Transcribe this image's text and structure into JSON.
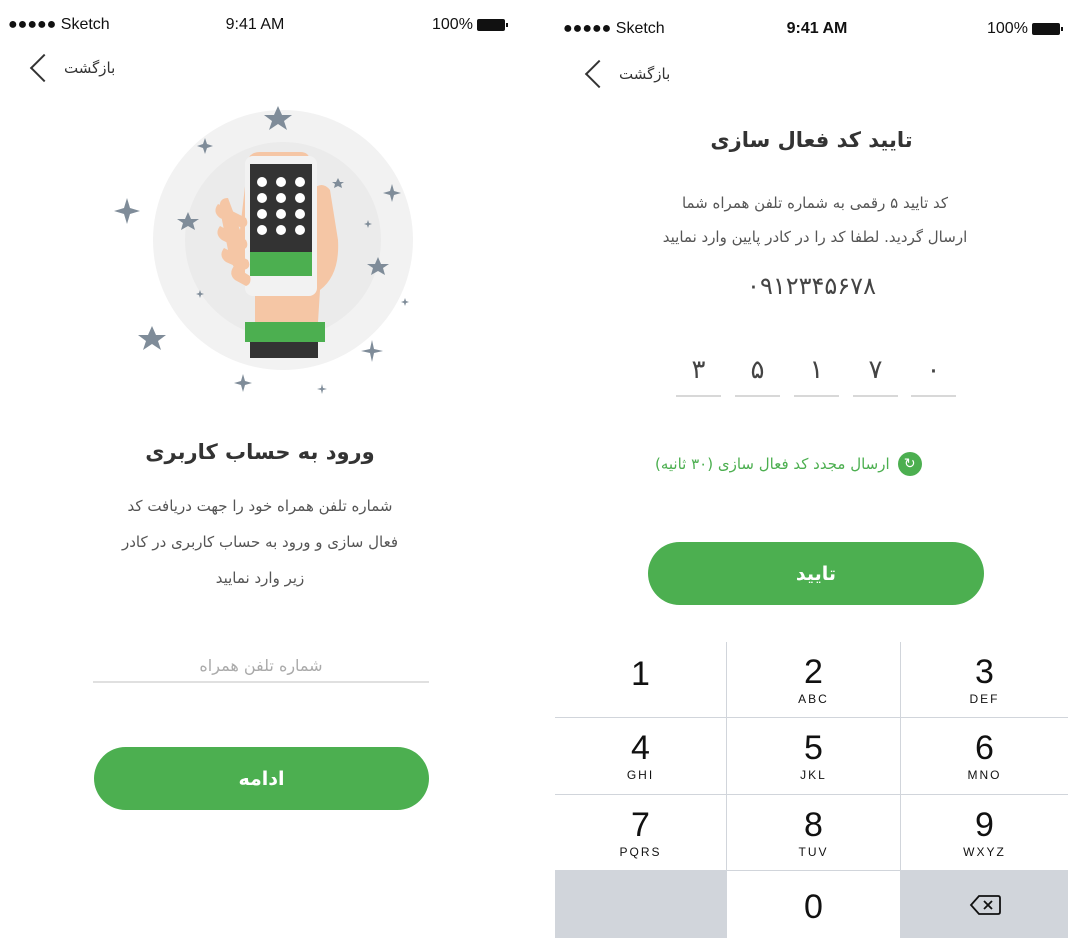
{
  "left_screen": {
    "status": {
      "carrier": "●●●●● Sketch",
      "time": "9:41 AM",
      "battery": "100%"
    },
    "back_label": "بازگشت",
    "title": "ورود به حساب کاربری",
    "description_lines": [
      "شماره تلفن همراه خود را جهت دریافت کد",
      "فعال سازی و ورود به حساب کاربری در کادر",
      "زیر وارد نمایید"
    ],
    "phone_placeholder": "شماره تلفن همراه",
    "continue_label": "ادامه"
  },
  "right_screen": {
    "status": {
      "carrier": "●●●●● Sketch",
      "time": "9:41 AM",
      "battery": "100%"
    },
    "back_label": "بازگشت",
    "title": "تایید کد فعال سازی",
    "description_lines": [
      "کد تایید ۵ رقمی به شماره تلفن همراه شما",
      "ارسال گردید. لطفا کد را در کادر پایین وارد نمایید"
    ],
    "phone_number": "۰۹۱۲۳۴۵۶۷۸",
    "code_digits": [
      "۳",
      "۵",
      "۱",
      "۷",
      "۰"
    ],
    "resend_label": "ارسال مجدد کد فعال سازی (۳۰ ثانیه)",
    "confirm_label": "تایید",
    "keypad": [
      {
        "digit": "1",
        "letters": ""
      },
      {
        "digit": "2",
        "letters": "ABC"
      },
      {
        "digit": "3",
        "letters": "DEF"
      },
      {
        "digit": "4",
        "letters": "GHI"
      },
      {
        "digit": "5",
        "letters": "JKL"
      },
      {
        "digit": "6",
        "letters": "MNO"
      },
      {
        "digit": "7",
        "letters": "PQRS"
      },
      {
        "digit": "8",
        "letters": "TUV"
      },
      {
        "digit": "9",
        "letters": "WXYZ"
      },
      {
        "digit": "",
        "letters": ""
      },
      {
        "digit": "0",
        "letters": ""
      },
      {
        "digit": "",
        "letters": ""
      }
    ]
  },
  "colors": {
    "accent": "#4caf50",
    "text": "#333333",
    "keypad_bg": "#d1d5db"
  }
}
